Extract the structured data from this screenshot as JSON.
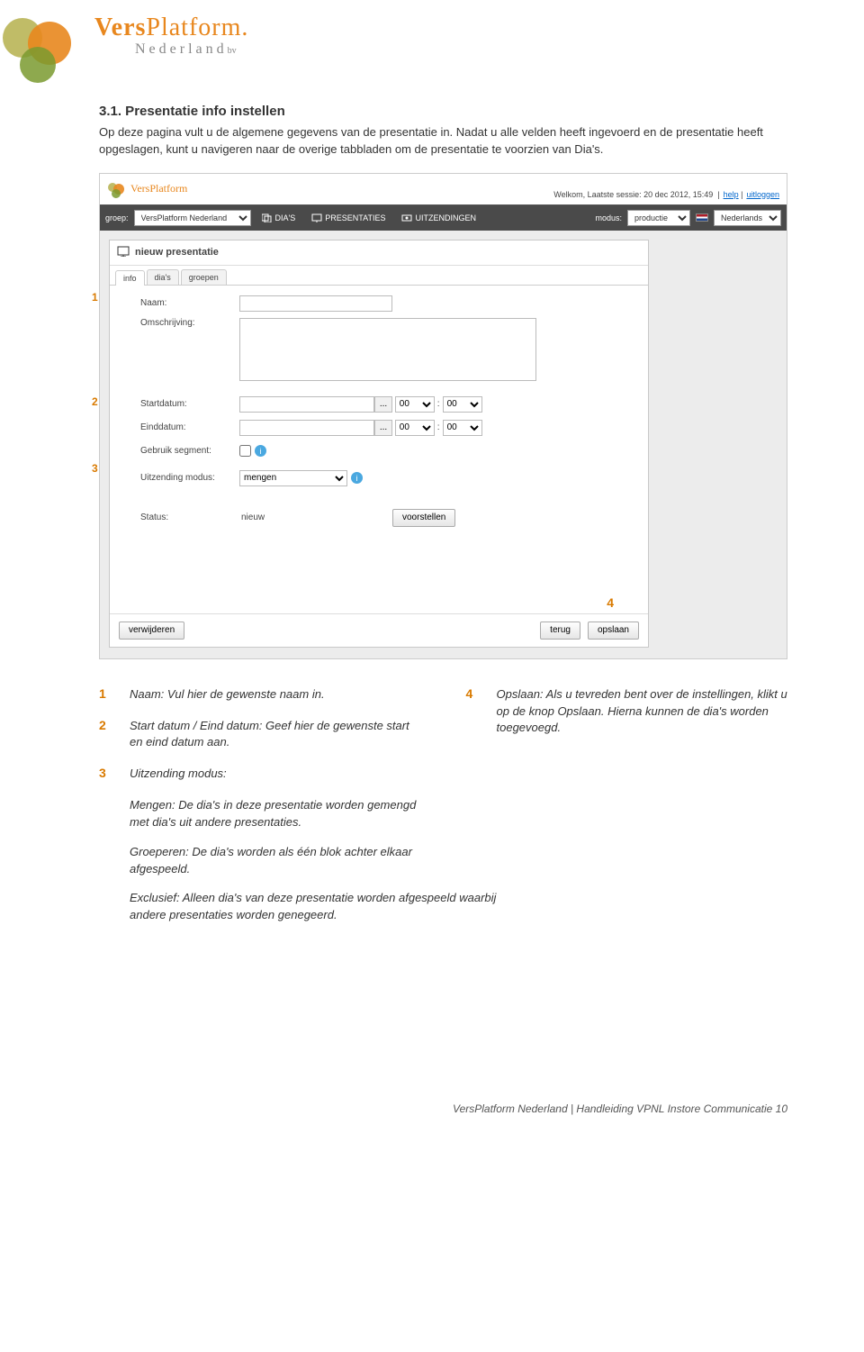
{
  "logo": {
    "brand_part1": "Vers",
    "brand_part2": "Platform",
    "brand_dot": ".",
    "subline": "Nederland",
    "subline_suffix": "bv"
  },
  "doc": {
    "heading": "3.1. Presentatie info instellen",
    "intro": "Op deze pagina vult u de algemene gegevens van de presentatie in. Nadat u alle velden heeft ingevoerd en de presentatie heeft opgeslagen, kunt u navigeren naar de overige tabbladen om de presentatie te voorzien van Dia's."
  },
  "screenshot": {
    "welcome_prefix": "Welkom, Laatste sessie: ",
    "welcome_date": "20 dec 2012, 15:49",
    "help": "help",
    "logout": "uitloggen",
    "nav": {
      "groep_label": "groep:",
      "groep_value": "VersPlatform Nederland",
      "dias": "DIA'S",
      "presentaties": "PRESENTATIES",
      "uitzendingen": "UITZENDINGEN",
      "modus_label": "modus:",
      "modus_value": "productie",
      "lang": "Nederlands"
    },
    "panel": {
      "title": "nieuw presentatie",
      "tabs": {
        "info": "info",
        "dias": "dia's",
        "groepen": "groepen"
      }
    },
    "form": {
      "naam_label": "Naam:",
      "omschrijving_label": "Omschrijving:",
      "startdatum_label": "Startdatum:",
      "einddatum_label": "Einddatum:",
      "time_hour": "00",
      "time_sep": ":",
      "time_min": "00",
      "gebruik_segment_label": "Gebruik segment:",
      "uitzending_modus_label": "Uitzending modus:",
      "uitzending_modus_value": "mengen",
      "status_label": "Status:",
      "status_value": "nieuw",
      "voorstellen_btn": "voorstellen",
      "verwijderen_btn": "verwijderen",
      "terug_btn": "terug",
      "opslaan_btn": "opslaan",
      "date_picker_btn": "..."
    },
    "annotations": {
      "n1": "1",
      "n2": "2",
      "n3": "3",
      "n4": "4"
    }
  },
  "legend": {
    "i1_num": "1",
    "i1": "Naam: Vul hier de gewenste naam in.",
    "i2_num": "2",
    "i2": "Start datum / Eind datum: Geef hier de gewenste start en eind datum aan.",
    "i3_num": "3",
    "i3_lead": "Uitzending modus:",
    "i3_mengen": "Mengen: De dia's in deze presentatie worden gemengd met dia's uit andere presentaties.",
    "i3_groeperen": "Groeperen: De dia's worden als één blok achter elkaar afgespeeld.",
    "i3_exclusief": "Exclusief: Alleen dia's van deze presentatie worden afgespeeld waarbij andere presentaties worden genegeerd.",
    "i4_num": "4",
    "i4": "Opslaan: Als u tevreden bent over de instellingen, klikt u op de knop Opslaan. Hierna kunnen de dia's worden toegevoegd."
  },
  "footer": {
    "text": "VersPlatform Nederland | Handleiding VPNL Instore Communicatie 10"
  }
}
